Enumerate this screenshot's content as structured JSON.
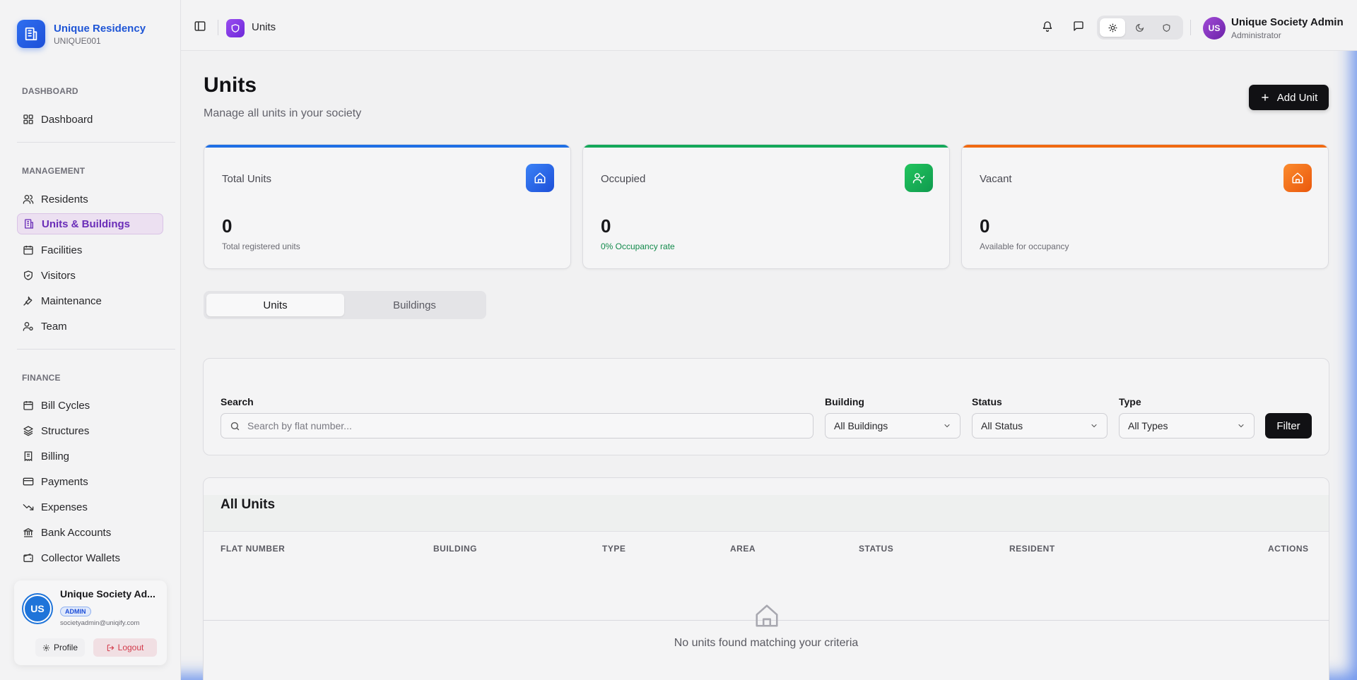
{
  "brand": {
    "name": "Unique Residency",
    "code": "UNIQUE001"
  },
  "sidebar": {
    "sections": [
      {
        "title": "DASHBOARD"
      },
      {
        "title": "MANAGEMENT"
      },
      {
        "title": "FINANCE"
      }
    ],
    "items": [
      {
        "label": "Dashboard",
        "icon": "grid-icon"
      },
      {
        "label": "Residents",
        "icon": "users-icon"
      },
      {
        "label": "Units & Buildings",
        "icon": "building-icon",
        "active": true
      },
      {
        "label": "Facilities",
        "icon": "calendar-icon"
      },
      {
        "label": "Visitors",
        "icon": "shield-icon"
      },
      {
        "label": "Maintenance",
        "icon": "wrench-icon"
      },
      {
        "label": "Team",
        "icon": "user-cog-icon"
      },
      {
        "label": "Bill Cycles",
        "icon": "calendar-icon"
      },
      {
        "label": "Structures",
        "icon": "layers-icon"
      },
      {
        "label": "Billing",
        "icon": "receipt-icon"
      },
      {
        "label": "Payments",
        "icon": "credit-card-icon"
      },
      {
        "label": "Expenses",
        "icon": "trending-down-icon"
      },
      {
        "label": "Bank Accounts",
        "icon": "bank-icon"
      },
      {
        "label": "Collector Wallets",
        "icon": "wallet-icon"
      }
    ]
  },
  "user_card": {
    "initials": "US",
    "name": "Unique Society Ad...",
    "role": "ADMIN",
    "email": "societyadmin@uniqify.com",
    "profile_label": "Profile",
    "logout_label": "Logout"
  },
  "topbar": {
    "page_title": "Units",
    "user_initials": "US",
    "user_name": "Unique Society Admin",
    "user_role": "Administrator"
  },
  "header": {
    "title": "Units",
    "subtitle": "Manage all units in your society",
    "add_button": "Add Unit"
  },
  "stats": [
    {
      "label": "Total Units",
      "value": "0",
      "note": "Total registered units",
      "accent": "#1f6fe5",
      "icon": "home-icon"
    },
    {
      "label": "Occupied",
      "value": "0",
      "note": "0% Occupancy rate",
      "accent": "#14a85a",
      "icon": "user-check-icon"
    },
    {
      "label": "Vacant",
      "value": "0",
      "note": "Available for occupancy",
      "accent": "#f06a12",
      "icon": "home-icon"
    }
  ],
  "tabs": [
    {
      "label": "Units",
      "active": true
    },
    {
      "label": "Buildings"
    }
  ],
  "filters": {
    "search_label": "Search",
    "search_placeholder": "Search by flat number...",
    "building_label": "Building",
    "building_value": "All Buildings",
    "status_label": "Status",
    "status_value": "All Status",
    "type_label": "Type",
    "type_value": "All Types",
    "filter_button": "Filter"
  },
  "table": {
    "title": "All Units",
    "columns": [
      "FLAT NUMBER",
      "BUILDING",
      "TYPE",
      "AREA",
      "STATUS",
      "RESIDENT",
      "ACTIONS"
    ],
    "empty_text": "No units found matching your criteria"
  }
}
